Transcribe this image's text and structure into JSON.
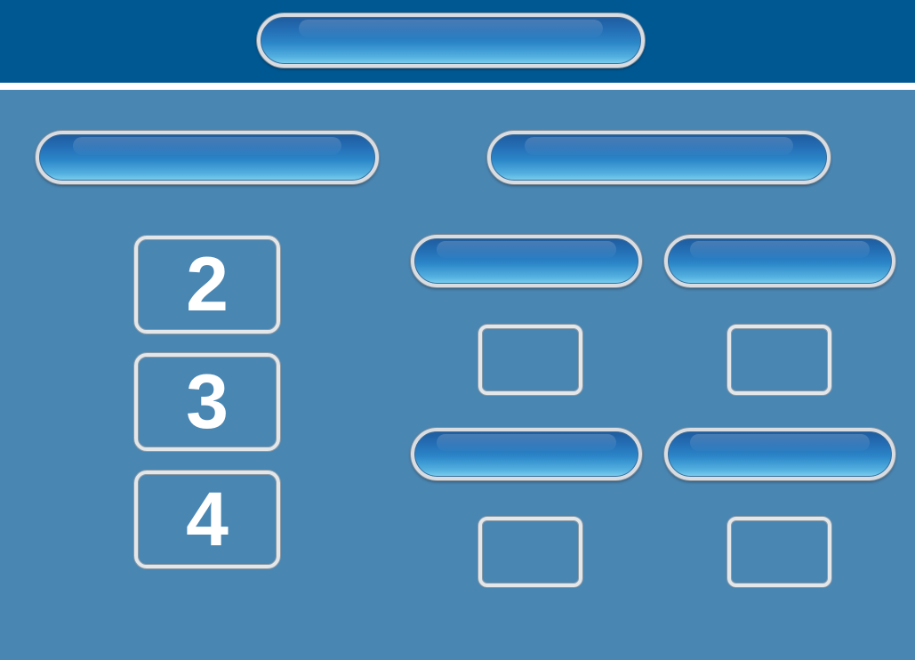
{
  "header": {
    "title_label": ""
  },
  "left_column": {
    "heading_label": "",
    "numbers": [
      "2",
      "3",
      "4"
    ]
  },
  "right_column": {
    "heading_label": "",
    "options": [
      {
        "label": "",
        "value": ""
      },
      {
        "label": "",
        "value": ""
      },
      {
        "label": "",
        "value": ""
      },
      {
        "label": "",
        "value": ""
      }
    ]
  },
  "colors": {
    "header_bg": "#005892",
    "panel_bg": "#4a86b2",
    "button_top": "#1f5b9e",
    "button_bottom": "#7cd0ef"
  }
}
